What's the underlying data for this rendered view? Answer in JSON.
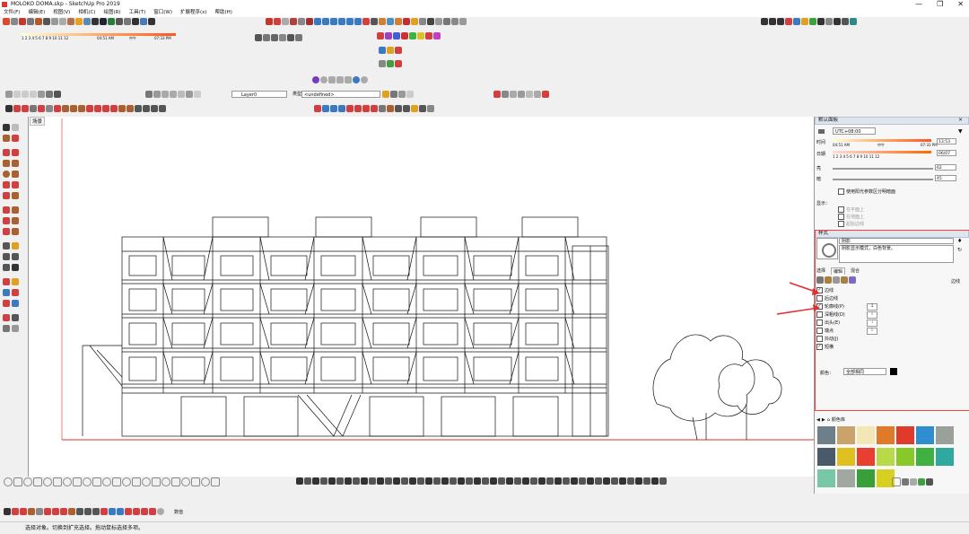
{
  "window": {
    "title": "MOLOKO DOMA.skp - SketchUp Pro 2019",
    "controls": [
      "—",
      "❐",
      "✕"
    ]
  },
  "menu": [
    "文件(F)",
    "编辑(E)",
    "视图(V)",
    "相机(C)",
    "绘图(R)",
    "工具(T)",
    "窗口(W)",
    "扩展程序(x)",
    "帮助(H)"
  ],
  "shadow_strip": {
    "months": "1 2 3 4 5 6 7 8 9 10 11 12",
    "time_start": "04:51 AM",
    "noon": "中午",
    "time_end": "07:33 PM"
  },
  "layer_toolbar": {
    "layer": "Layer0",
    "type_label": "类型：",
    "type_value": "<undefined>"
  },
  "scene_tab": "场景",
  "panel": {
    "tray_title": "默认面板",
    "timezone": "UTC+08:00",
    "time_label": "时间",
    "date_label": "日期",
    "time_start": "04:51 AM",
    "noon": "中午",
    "time_end": "07:33 PM",
    "time_value": "13:53",
    "date_value": "06/07",
    "months": "1 2 3 4 5 6 7 8 9 10 11 12",
    "light_label": "亮",
    "light_value": "62",
    "dark_label": "暗",
    "dark_value": "45",
    "sun_shading": "使用阳光参数区分明暗面",
    "display_label": "显示：",
    "display_opts": [
      "在平面上",
      "在地面上",
      "起始边线"
    ],
    "styles_title": "样式",
    "style_name": "阴影",
    "style_desc": "阴影显示模式，白色背景。",
    "tabs": [
      "选择",
      "编辑",
      "混合"
    ],
    "edge_label": "边线",
    "edge_settings": [
      {
        "label": "边线",
        "checked": true,
        "value": ""
      },
      {
        "label": "后边线",
        "checked": false,
        "value": ""
      },
      {
        "label": "轮廓线(P)",
        "checked": true,
        "value": "1"
      },
      {
        "label": "深粗线(D)",
        "checked": false,
        "value": "4"
      },
      {
        "label": "出头(E)",
        "checked": false,
        "value": "3"
      },
      {
        "label": "端点",
        "checked": false,
        "value": "6"
      },
      {
        "label": "抖动(J)",
        "checked": false,
        "value": ""
      },
      {
        "label": "短横",
        "checked": true,
        "value": ""
      }
    ],
    "color_label": "颜色：",
    "color_value": "全部相同",
    "materials_title": "颜色库",
    "accent": "#ff0000",
    "material_colors": [
      "#6e7f8a",
      "#c9a36a",
      "#f2e7b5",
      "#e07a2a",
      "#e03a2a",
      "#2f8ecf",
      "#9aa19a",
      "#4a5a6a",
      "#e0c020",
      "#e84030",
      "#b9d84a",
      "#88c828",
      "#40b040",
      "#30a8a0",
      "#78c8a8",
      "#a0a8a0",
      "#38a038",
      "#d8d020"
    ]
  },
  "status": {
    "text": "选择对象。切换到扩充选择。拖动鼠标选择多项。",
    "measure_label": "数值"
  },
  "annotations": {
    "arrow_color": "#e03030"
  }
}
